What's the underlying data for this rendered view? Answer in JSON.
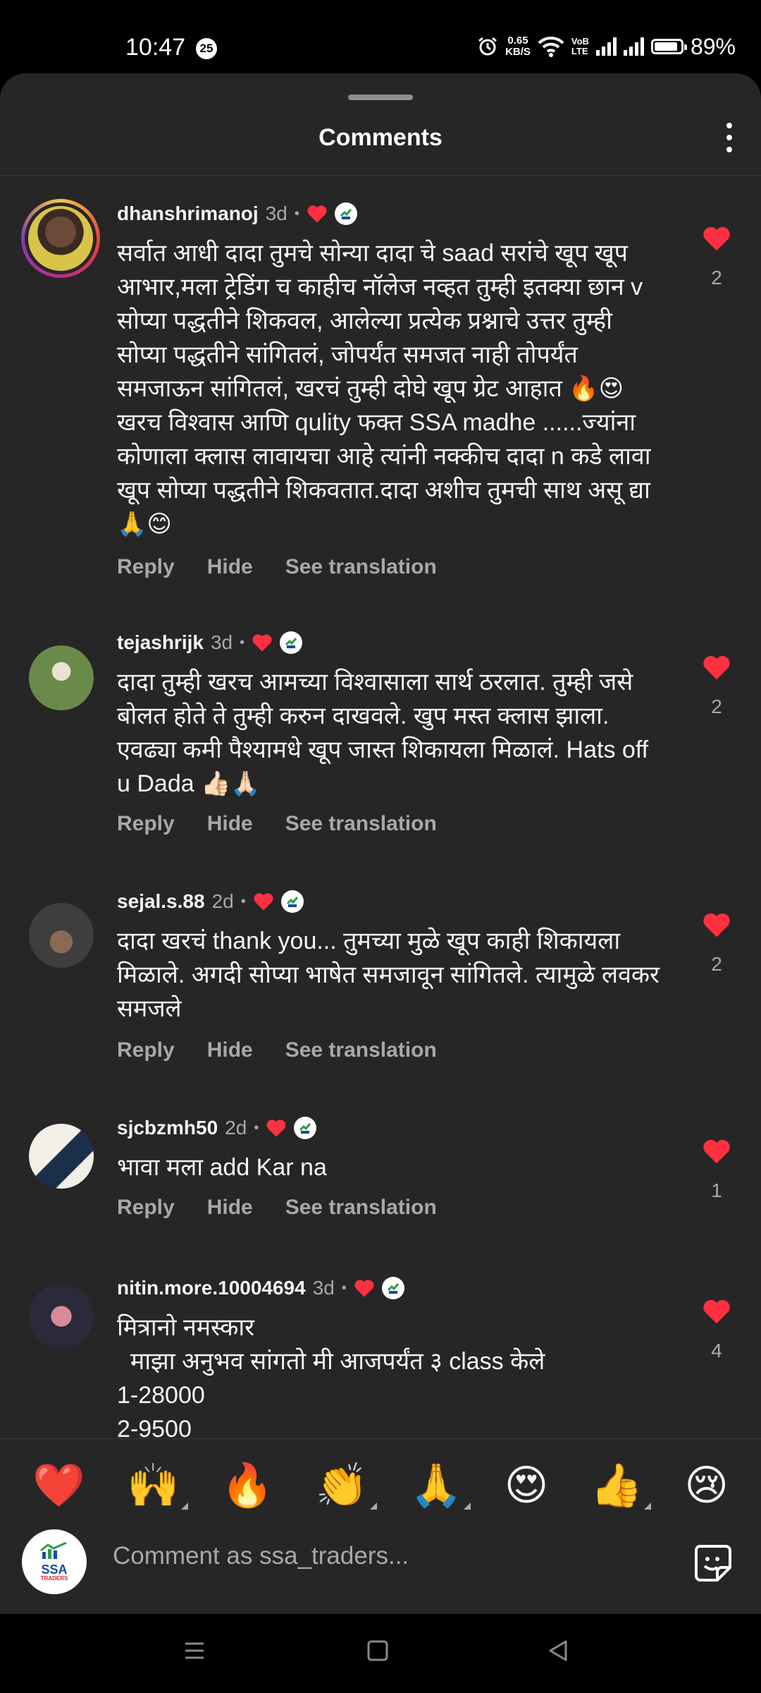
{
  "status_bar": {
    "time": "10:47",
    "notification_count": "25",
    "speed_value": "0.65",
    "speed_unit": "KB/S",
    "volte_top": "VoB",
    "volte_bottom": "LTE",
    "battery_percent": "89%",
    "battery_level": 0.89
  },
  "sheet": {
    "title": "Comments"
  },
  "comments": [
    {
      "username": "dhanshrimanoj",
      "time": "3d",
      "text": "सर्वात आधी दादा तुमचे सोन्या दादा चे saad सरांचे खूप खूप आभार,मला ट्रेडिंग च काहीच नॉलेज नव्हत तुम्ही इतक्या छान v सोप्या पद्धतीने शिकवल, आलेल्या प्रत्येक प्रश्नाचे उत्तर तुम्ही सोप्या पद्धतीने सांगितलं, जोपर्यंत समजत नाही तोपर्यंत समजाऊन सांगितलं, खरचं तुम्ही दोघे खूप ग्रेट आहात 🔥😍 खरच विश्वास आणि qulity फक्त SSA madhe ......ज्यांना कोणाला क्लास लावायचा आहे त्यांनी नक्कीच दादा n कडे लावा खूप सोप्या पद्धतीने शिकवतात.दादा अशीच तुमची साथ असू द्या🙏😊",
      "likes": "2"
    },
    {
      "username": "tejashrijk",
      "time": "3d",
      "text": "दादा तुम्ही खरच आमच्या विश्वासाला सार्थ ठरलात. तुम्ही जसे बोलत होते ते तुम्ही करुन दाखवले. खुप मस्त क्लास झाला. एवढ्या कमी पैश्यामधे खूप जास्त शिकायला मिळालं. Hats off u Dada 👍🏻🙏🏻",
      "likes": "2"
    },
    {
      "username": "sejal.s.88",
      "time": "2d",
      "text": "दादा खरचं thank you... तुमच्या मुळे खूप काही शिकायला मिळाले. अगदी सोप्या भाषेत समजावून सांगितले. त्यामुळे लवकर समजले",
      "likes": "2"
    },
    {
      "username": "sjcbzmh50",
      "time": "2d",
      "text": "भावा मला add Kar na",
      "likes": "1"
    },
    {
      "username": "nitin.more.10004694",
      "time": "3d",
      "text": "मित्रानो नमस्कार\n  माझा अनुभव सांगतो मी आजपर्यंत ३ class केले\n1-28000\n2-9500",
      "likes": "4"
    }
  ],
  "actions": {
    "reply": "Reply",
    "hide": "Hide",
    "see_translation": "See translation"
  },
  "reactions": [
    "❤️",
    "🙌",
    "🔥",
    "👏",
    "🙏",
    "😍",
    "👍",
    "😢"
  ],
  "composer": {
    "placeholder": "Comment as ssa_traders...",
    "avatar_text_top": "SSA",
    "avatar_text_bottom": "TRADERS"
  }
}
